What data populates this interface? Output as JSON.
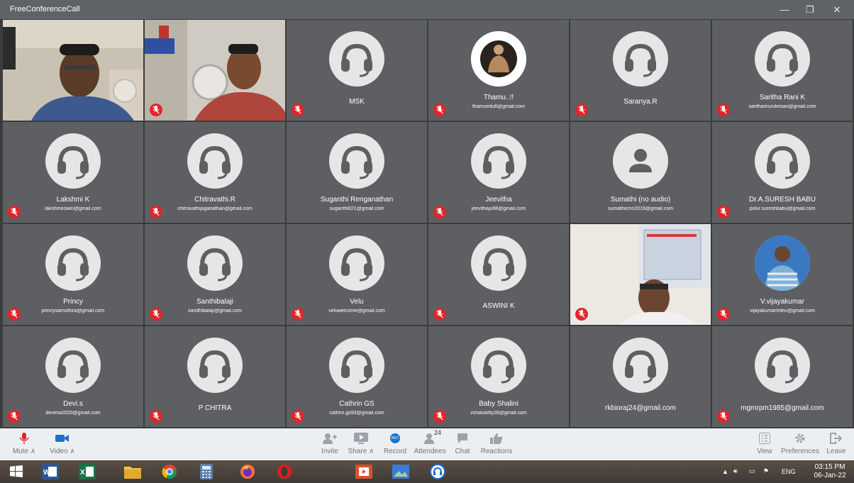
{
  "window": {
    "title": "FreeConferenceCall",
    "minimize": "—",
    "maximize": "❐",
    "close": "✕"
  },
  "participants": [
    {
      "type": "video",
      "speaking": true,
      "muted": false
    },
    {
      "type": "video",
      "speaking": false,
      "muted": true
    },
    {
      "type": "headset",
      "name": "MSK",
      "email": "",
      "muted": true
    },
    {
      "type": "photo",
      "name": "Thamu..!!",
      "email": "thamuedu6@gmail.com",
      "muted": true
    },
    {
      "type": "headset",
      "name": "Saranya.R",
      "email": "",
      "muted": true
    },
    {
      "type": "headset",
      "name": "Saritha Rani K",
      "email": "sarithamurukesan@gmail.com",
      "muted": true
    },
    {
      "type": "headset",
      "name": "Lakshmi K",
      "email": "lakshmirowin@gmail.com",
      "muted": true
    },
    {
      "type": "headset",
      "name": "Chitravathi.R",
      "email": "chitravathijaganathan@gmail.com",
      "muted": true
    },
    {
      "type": "headset",
      "name": "Suganthi Renganathan",
      "email": "suganthi021@gmail.com",
      "muted": true
    },
    {
      "type": "headset",
      "name": "Jeevitha",
      "email": "jeevithaju98@gmail.com",
      "muted": true
    },
    {
      "type": "person",
      "name": "Sumathi (no audio)",
      "email": "sumathicms2019@gmail.com",
      "muted": false
    },
    {
      "type": "headset",
      "name": "Dr.A.SURESH BABU",
      "email": "polur.sureshbabu@gmail.com",
      "muted": true
    },
    {
      "type": "headset",
      "name": "Princy",
      "email": "princysamuthira@gmail.com",
      "muted": true
    },
    {
      "type": "headset",
      "name": "Santhibalaji",
      "email": "sandhibalaji@gmail.com",
      "muted": true
    },
    {
      "type": "headset",
      "name": "Velu",
      "email": "veluwelcome@gmail.com",
      "muted": true
    },
    {
      "type": "headset",
      "name": "ASWINI K",
      "email": "",
      "muted": true
    },
    {
      "type": "video",
      "speaking": false,
      "muted": true
    },
    {
      "type": "photo",
      "name": "V.vijayakumar",
      "email": "vijayakumartnteu@gmail.com",
      "muted": true
    },
    {
      "type": "headset",
      "name": "Devi.s",
      "email": "devima2020@gmail.com",
      "muted": true
    },
    {
      "type": "headset",
      "name": "P CHITRA",
      "email": "",
      "muted": true
    },
    {
      "type": "headset",
      "name": "Cathrin GS",
      "email": "cathrin.gs93@gmail.com",
      "muted": true
    },
    {
      "type": "headset",
      "name": "Baby Shalini",
      "email": "vshalukitty28@gmail.com",
      "muted": true
    },
    {
      "type": "headset",
      "name": "rkbioraj24@gmail.com",
      "email": "",
      "muted": true
    },
    {
      "type": "headset",
      "name": "mgmrpm1985@gmail.com",
      "email": "",
      "muted": true
    }
  ],
  "controls": {
    "mute": "Mute ∧",
    "video": "Video ∧",
    "invite": "Invite",
    "share": "Share ∧",
    "record": "Record",
    "record_badge": "REC",
    "attendees": "Attendees",
    "attendee_count": "24",
    "chat": "Chat",
    "reactions": "Reactions",
    "view": "View",
    "preferences": "Preferences",
    "leave": "Leave"
  },
  "taskbar": {
    "language": "ENG",
    "time": "03:15 PM",
    "date": "06-Jan-22"
  },
  "colors": {
    "tile": "#5d5f62",
    "mute_badge": "#e0262b",
    "speaking_border": "#2ecc40",
    "control_bar": "#eceff1"
  }
}
